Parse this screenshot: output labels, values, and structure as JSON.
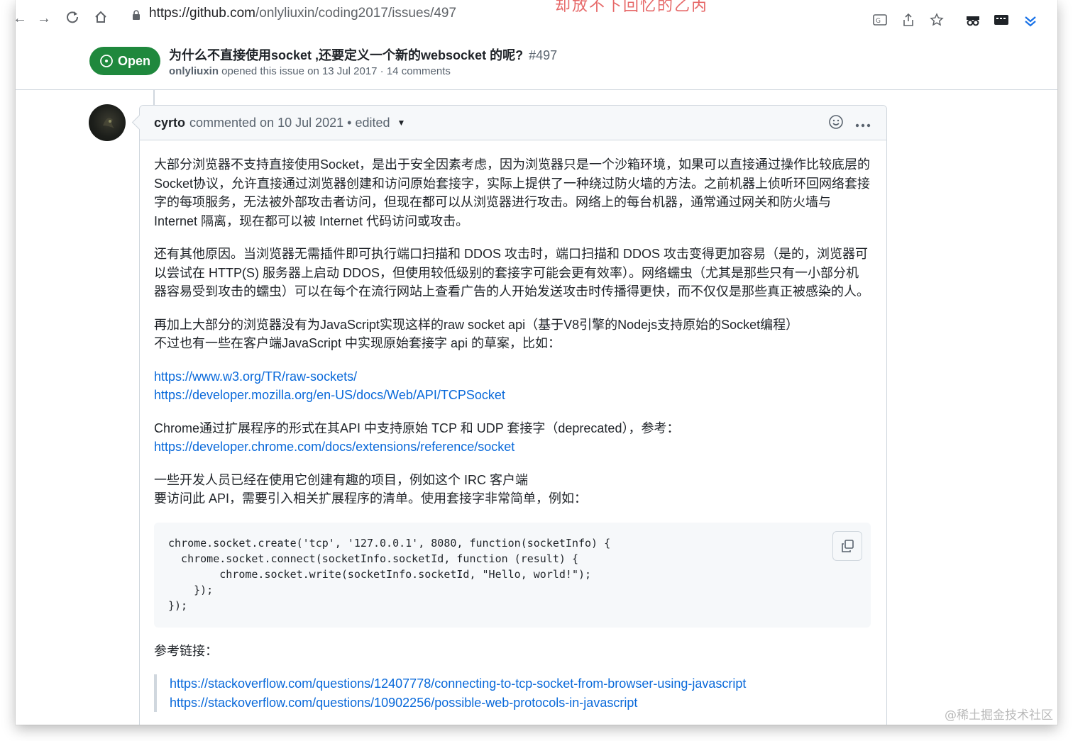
{
  "browser": {
    "url_host": "https://github.com",
    "url_path": "/onlyliuxin/coding2017/issues/497",
    "cut_overlay_text": "却放不下回忆的乙丙"
  },
  "issue": {
    "state": "Open",
    "title": "为什么不直接使用socket ,还要定义一个新的websocket 的呢?",
    "number": "#497",
    "author": "onlyliuxin",
    "meta_rest": " opened this issue on 13 Jul 2017 · 14 comments"
  },
  "comment": {
    "author": "cyrto",
    "meta": "commented on 10 Jul 2021 • edited",
    "paragraphs": {
      "p1": "大部分浏览器不支持直接使用Socket，是出于安全因素考虑，因为浏览器只是一个沙箱环境，如果可以直接通过操作比较底层的Socket协议，允许直接通过浏览器创建和访问原始套接字，实际上提供了一种绕过防火墙的方法。之前机器上侦听环回网络套接字的每项服务，无法被外部攻击者访问，但现在都可以从浏览器进行攻击。网络上的每台机器，通常通过网关和防火墙与 Internet 隔离，现在都可以被 Internet 代码访问或攻击。",
      "p2": "还有其他原因。当浏览器无需插件即可执行端口扫描和 DDOS 攻击时，端口扫描和 DDOS 攻击变得更加容易（是的，浏览器可以尝试在 HTTP(S) 服务器上启动 DDOS，但使用较低级别的套接字可能会更有效率）。网络蠕虫（尤其是那些只有一小部分机器容易受到攻击的蠕虫）可以在每个在流行网站上查看广告的人开始发送攻击时传播得更快，而不仅仅是那些真正被感染的人。",
      "p3a": "再加上大部分的浏览器没有为JavaScript实现这样的raw socket api（基于V8引擎的Nodejs支持原始的Socket编程）",
      "p3b": "不过也有一些在客户端JavaScript 中实现原始套接字 api 的草案，比如：",
      "link1": "https://www.w3.org/TR/raw-sockets/",
      "link2": "https://developer.mozilla.org/en-US/docs/Web/API/TCPSocket",
      "p4": "Chrome通过扩展程序的形式在其API 中支持原始 TCP 和 UDP 套接字（deprecated），参考：",
      "link3": "https://developer.chrome.com/docs/extensions/reference/socket",
      "p5a": "一些开发人员已经在使用它创建有趣的项目，例如这个 IRC 客户端",
      "p5b": "要访问此 API，需要引入相关扩展程序的清单。使用套接字非常简单，例如：",
      "code": "chrome.socket.create('tcp', '127.0.0.1', 8080, function(socketInfo) {\n  chrome.socket.connect(socketInfo.socketId, function (result) {\n        chrome.socket.write(socketInfo.socketId, \"Hello, world!\");\n    });\n});",
      "refs_label": "参考链接：",
      "ref1": "https://stackoverflow.com/questions/12407778/connecting-to-tcp-socket-from-browser-using-javascript",
      "ref2": "https://stackoverflow.com/questions/10902256/possible-web-protocols-in-javascript"
    }
  },
  "watermark": "@稀土掘金技术社区"
}
